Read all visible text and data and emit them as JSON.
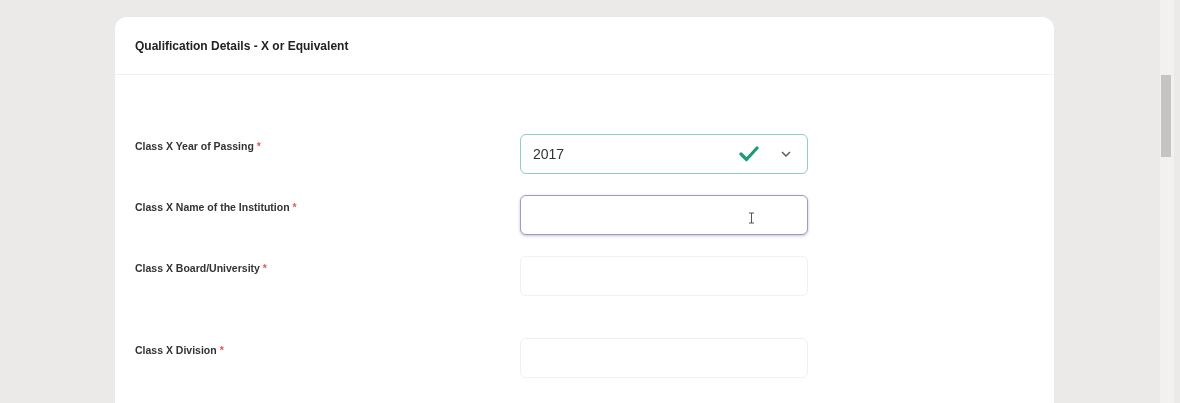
{
  "card": {
    "title": "Qualification Details - X or Equivalent"
  },
  "fields": [
    {
      "kind": "select",
      "label": "Class X Year of Passing",
      "asterisk": "*",
      "value": "2017",
      "valid": true,
      "focused": false
    },
    {
      "kind": "text",
      "label": "Class X Name of the Institution",
      "asterisk": "*",
      "valid": false,
      "focused": true
    },
    {
      "kind": "text",
      "label": "Class X Board/University",
      "asterisk": "*",
      "valid": false,
      "focused": false
    },
    {
      "kind": "text",
      "label": "Class X Division",
      "asterisk": "*",
      "valid": false,
      "focused": false
    }
  ]
}
